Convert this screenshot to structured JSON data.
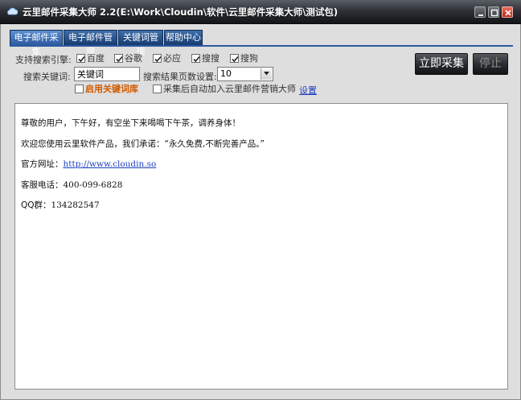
{
  "window": {
    "title": "云里邮件采集大师  2.2(E:\\Work\\Cloudin\\软件\\云里邮件采集大师\\测试包)"
  },
  "tabs": [
    {
      "label": "电子邮件采集",
      "active": true
    },
    {
      "label": "电子邮件管理",
      "active": false
    },
    {
      "label": "关键词管理",
      "active": false
    },
    {
      "label": "帮助中心",
      "active": false
    }
  ],
  "form": {
    "engines_label": "支持搜索引擎:",
    "engines": [
      {
        "label": "百度",
        "checked": true
      },
      {
        "label": "谷歌",
        "checked": true
      },
      {
        "label": "必应",
        "checked": true
      },
      {
        "label": "搜搜",
        "checked": true
      },
      {
        "label": "搜狗",
        "checked": true
      }
    ],
    "keyword_label": "搜索关键词:",
    "keyword_value": "关键词",
    "pages_label": "搜索结果页数设置:",
    "pages_value": "10",
    "enable_keyword_lib": {
      "label": "启用关键词库",
      "checked": false
    },
    "auto_add": {
      "label": "采集后自动加入云里邮件营销大师",
      "checked": false
    },
    "settings_link": "设置"
  },
  "buttons": {
    "start": "立即采集",
    "stop": "停止"
  },
  "content": {
    "greeting": "尊敬的用户，下午好，有空坐下来喝喝下午茶，调养身体！",
    "welcome": "欢迎您使用云里软件产品，我们承诺：“永久免费,不断完善产品。”",
    "website_label": "官方网址：",
    "website_url": "http://www.cloudin.so",
    "phone_label": "客服电话：",
    "phone": "400-099-6828",
    "qq_label": "QQ群：",
    "qq": "134282547"
  }
}
